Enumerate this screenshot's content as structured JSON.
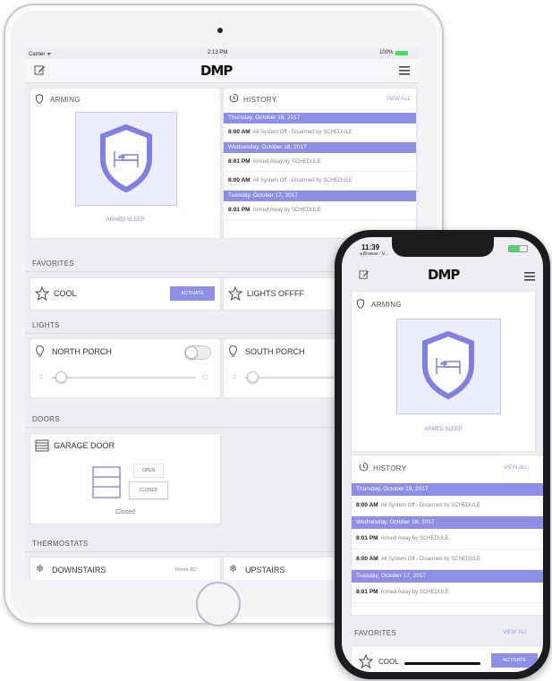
{
  "ipad": {
    "status": {
      "carrier": "Carrier ᯤ",
      "time": "2:13 PM",
      "battery": "100%"
    },
    "logo": "DMP",
    "arming": {
      "title": "ARMING",
      "state": "ARMED SLEEP"
    },
    "history": {
      "title": "HISTORY",
      "view_all": "VIEW ALL",
      "groups": [
        {
          "date": "Thursday, October 19, 2017",
          "rows": [
            {
              "time": "8:00 AM",
              "text": "All System Off - Disarmed by SCHEDULE"
            }
          ]
        },
        {
          "date": "Wednesday, October 18, 2017",
          "rows": [
            {
              "time": "8:01 PM",
              "text": "Armed Away by SCHEDULE"
            },
            {
              "time": "8:00 AM",
              "text": "All System Off - Disarmed by SCHEDULE"
            }
          ]
        },
        {
          "date": "Tuesday, October 17, 2017",
          "rows": [
            {
              "time": "8:01 PM",
              "text": "Armed Away by SCHEDULE"
            }
          ]
        }
      ]
    },
    "favorites": {
      "title": "FAVORITES",
      "items": [
        {
          "label": "COOL",
          "action": "ACTIVATE"
        },
        {
          "label": "LIGHTS OFFFF"
        }
      ]
    },
    "lights": {
      "title": "LIGHTS",
      "items": [
        {
          "label": "NORTH PORCH"
        },
        {
          "label": "SOUTH PORCH"
        }
      ]
    },
    "doors": {
      "title": "DOORS",
      "item": {
        "label": "GARAGE DOOR",
        "open": "OPEN",
        "closed": "CLOSED",
        "state": "Closed"
      }
    },
    "thermostats": {
      "title": "THERMOSTATS",
      "items": [
        {
          "label": "DOWNSTAIRS",
          "room": "Room 80°"
        },
        {
          "label": "UPSTAIRS"
        }
      ]
    }
  },
  "iphone": {
    "status": {
      "time": "11:39",
      "back": "◂ Browse · V..."
    },
    "logo": "DMP",
    "arming": {
      "title": "ARMING",
      "state": "ARMED SLEEP"
    },
    "history": {
      "title": "HISTORY",
      "view_all": "VIEW ALL",
      "groups": [
        {
          "date": "Thursday, October 19, 2017",
          "rows": [
            {
              "time": "8:00 AM",
              "text": "All System Off - Disarmed by SCHEDULE"
            }
          ]
        },
        {
          "date": "Wednesday, October 18, 2017",
          "rows": [
            {
              "time": "8:01 PM",
              "text": "Armed Away by SCHEDULE"
            },
            {
              "time": "8:00 AM",
              "text": "All System Off - Disarmed by SCHEDULE"
            }
          ]
        },
        {
          "date": "Tuesday, October 17, 2017",
          "rows": [
            {
              "time": "8:01 PM",
              "text": "Armed Away by SCHEDULE"
            }
          ]
        }
      ]
    },
    "favorites": {
      "title": "FAVORITES",
      "view_all": "VIEW ALL",
      "items": [
        {
          "label": "COOL",
          "action": "ACTIVATE"
        }
      ]
    }
  },
  "colors": {
    "accent": "#8d8ee6",
    "shield": "#7f80e0",
    "logo_gold": "#c7b24a"
  }
}
